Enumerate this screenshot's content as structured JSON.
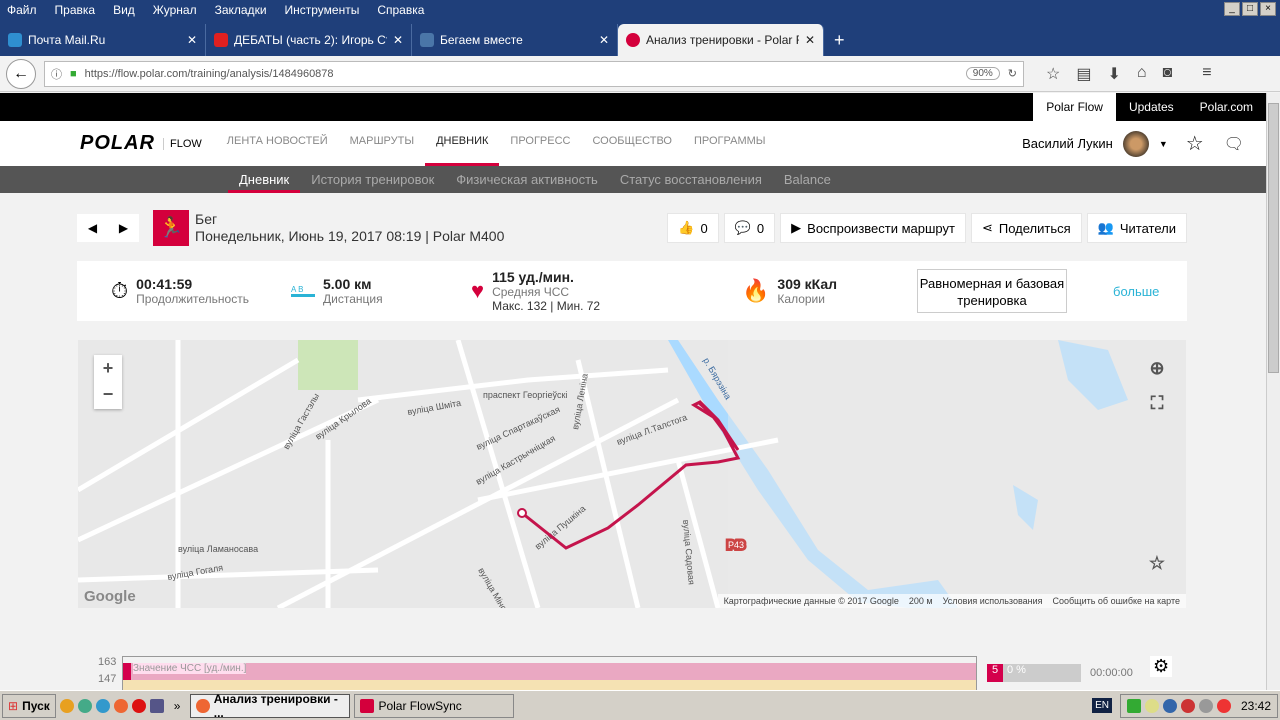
{
  "browser": {
    "menu": [
      "Файл",
      "Правка",
      "Вид",
      "Журнал",
      "Закладки",
      "Инструменты",
      "Справка"
    ],
    "tabs": [
      {
        "title": "Почта Mail.Ru",
        "color": "#2f8fd0"
      },
      {
        "title": "ДЕБАТЫ (часть 2): Игорь Ст...",
        "color": "#e02020"
      },
      {
        "title": "Бегаем вместе",
        "color": "#4a76a8"
      },
      {
        "title": "Анализ тренировки - Polar F...",
        "color": "#d4003c"
      }
    ],
    "url": "https://flow.polar.com/training/analysis/1484960878",
    "zoom": "90%"
  },
  "topbar": {
    "links": [
      "Polar Flow",
      "Updates",
      "Polar.com"
    ]
  },
  "header": {
    "logo": "POLAR",
    "product": "FLOW",
    "nav": [
      "ЛЕНТА НОВОСТЕЙ",
      "МАРШРУТЫ",
      "ДНЕВНИК",
      "ПРОГРЕСС",
      "СООБЩЕСТВО",
      "ПРОГРАММЫ"
    ],
    "user": "Василий Лукин"
  },
  "subnav": [
    "Дневник",
    "История тренировок",
    "Физическая активность",
    "Статус восстановления",
    "Balance"
  ],
  "training": {
    "sport": "Бег",
    "details": "Понедельник, Июнь 19, 2017 08:19 | Polar M400",
    "likes": "0",
    "comments": "0",
    "replay": "Воспроизвести маршрут",
    "share": "Поделиться",
    "readers": "Читатели"
  },
  "summary": {
    "duration": "00:41:59",
    "duration_label": "Продолжительность",
    "distance_ab": "A  B",
    "distance": "5.00 км",
    "distance_label": "Дистанция",
    "hr": "115 уд./мин.",
    "hr_label": "Средняя ЧСС",
    "hr_max": "Макс. 132",
    "hr_min": "Мин. 72",
    "calories": "309 кКал",
    "calories_label": "Калории",
    "type": "Равномерная и базовая тренировка",
    "more": "больше"
  },
  "map": {
    "zoom_in": "+",
    "zoom_out": "−",
    "google": "Google",
    "attribution": "Картографические данные © 2017 Google",
    "scale": "200 м",
    "terms": "Условия использования",
    "report": "Сообщить об ошибке на карте",
    "labels": [
      "праспект Георгіеўскі",
      "вуліца Мінская",
      "вуліца Крылова",
      "вуліца Леніна",
      "вуліца Пушкіна",
      "вуліца Кастрычніцкая",
      "вуліца Спартакаўская",
      "вуліца Л.Талстога",
      "вуліца Садовая",
      "вуліца Гогаля",
      "вуліца Ламаносава",
      "р. Бярэзіна",
      "P43",
      "вуліца Шміта",
      "вуліца Гастэлы"
    ]
  },
  "chart": {
    "y_ticks": [
      "163",
      "147"
    ],
    "series_label": "Значение ЧСС [уд./мин.]",
    "zone": "5",
    "zone_pct": "0 %",
    "zone_time": "00:00:00"
  },
  "taskbar": {
    "start": "Пуск",
    "windows": [
      "Анализ тренировки - ...",
      "Polar FlowSync"
    ],
    "lang": "EN",
    "clock": "23:42",
    "more": "»"
  }
}
